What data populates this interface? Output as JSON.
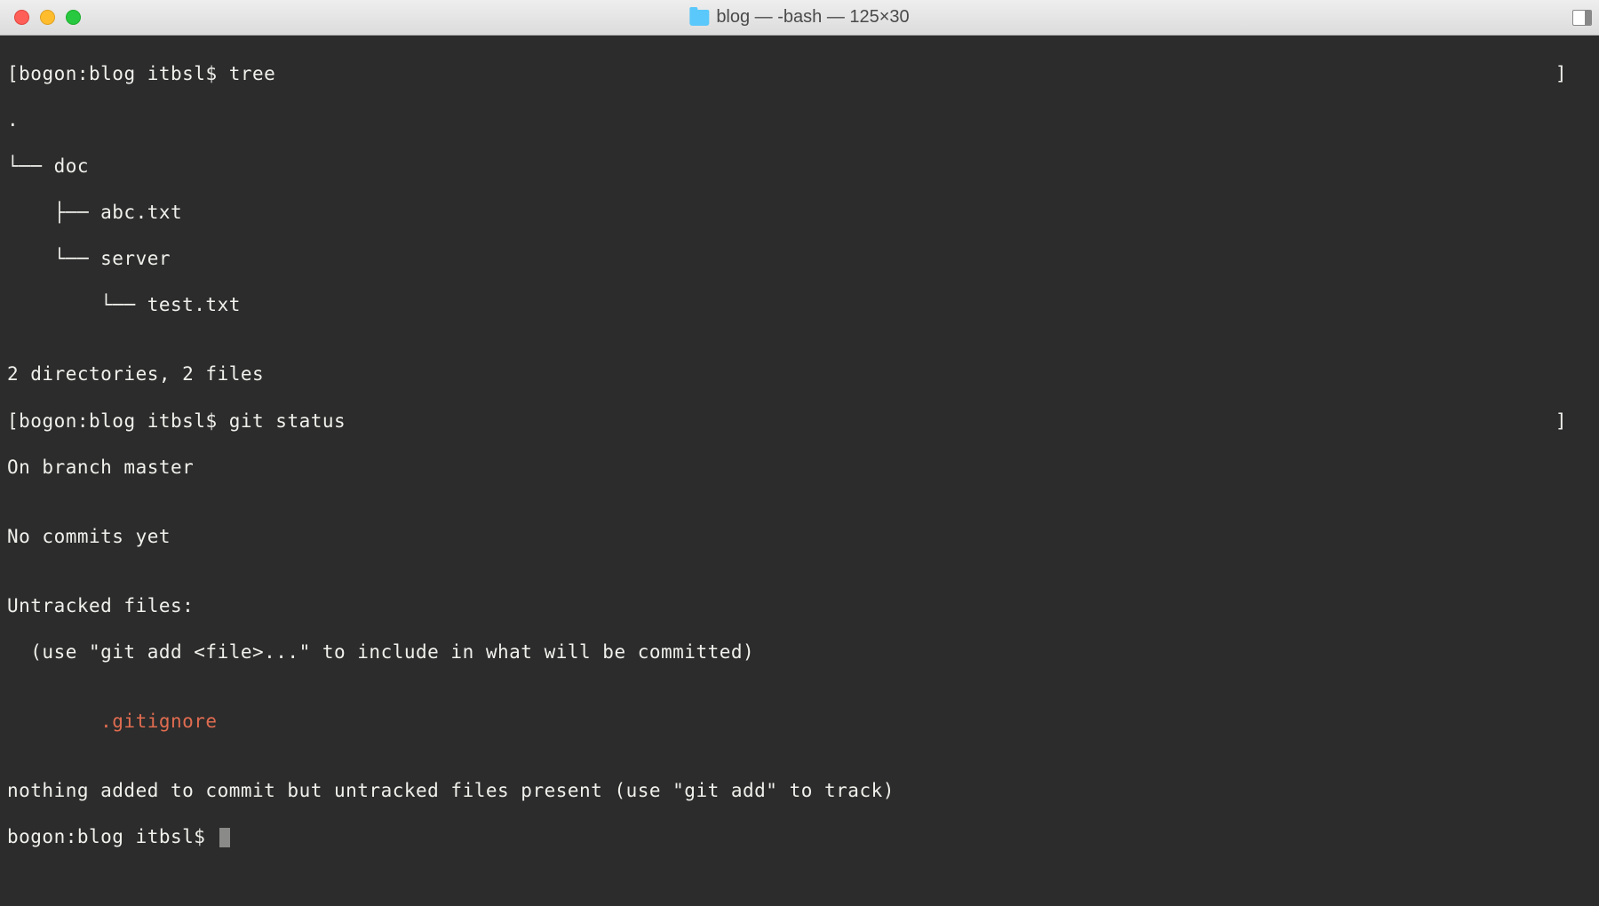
{
  "window": {
    "title": "blog — -bash — 125×30"
  },
  "terminal": {
    "prompt_bracket_open": "[",
    "prompt_bracket_close": "]",
    "lines": [
      {
        "type": "prompt",
        "prompt": "bogon:blog itbsl$ ",
        "cmd": "tree",
        "right_bracket": true
      },
      {
        "type": "out",
        "text": "."
      },
      {
        "type": "out",
        "text": "└── doc"
      },
      {
        "type": "out",
        "text": "    ├── abc.txt"
      },
      {
        "type": "out",
        "text": "    └── server"
      },
      {
        "type": "out",
        "text": "        └── test.txt"
      },
      {
        "type": "blank",
        "text": ""
      },
      {
        "type": "out",
        "text": "2 directories, 2 files"
      },
      {
        "type": "prompt",
        "prompt": "bogon:blog itbsl$ ",
        "cmd": "git status",
        "right_bracket": true
      },
      {
        "type": "out",
        "text": "On branch master"
      },
      {
        "type": "blank",
        "text": ""
      },
      {
        "type": "out",
        "text": "No commits yet"
      },
      {
        "type": "blank",
        "text": ""
      },
      {
        "type": "out",
        "text": "Untracked files:"
      },
      {
        "type": "out",
        "text": "  (use \"git add <file>...\" to include in what will be committed)"
      },
      {
        "type": "blank",
        "text": ""
      },
      {
        "type": "red",
        "text": "        .gitignore"
      },
      {
        "type": "blank",
        "text": ""
      },
      {
        "type": "out",
        "text": "nothing added to commit but untracked files present (use \"git add\" to track)"
      },
      {
        "type": "final_prompt",
        "prompt": "bogon:blog itbsl$ "
      }
    ]
  }
}
